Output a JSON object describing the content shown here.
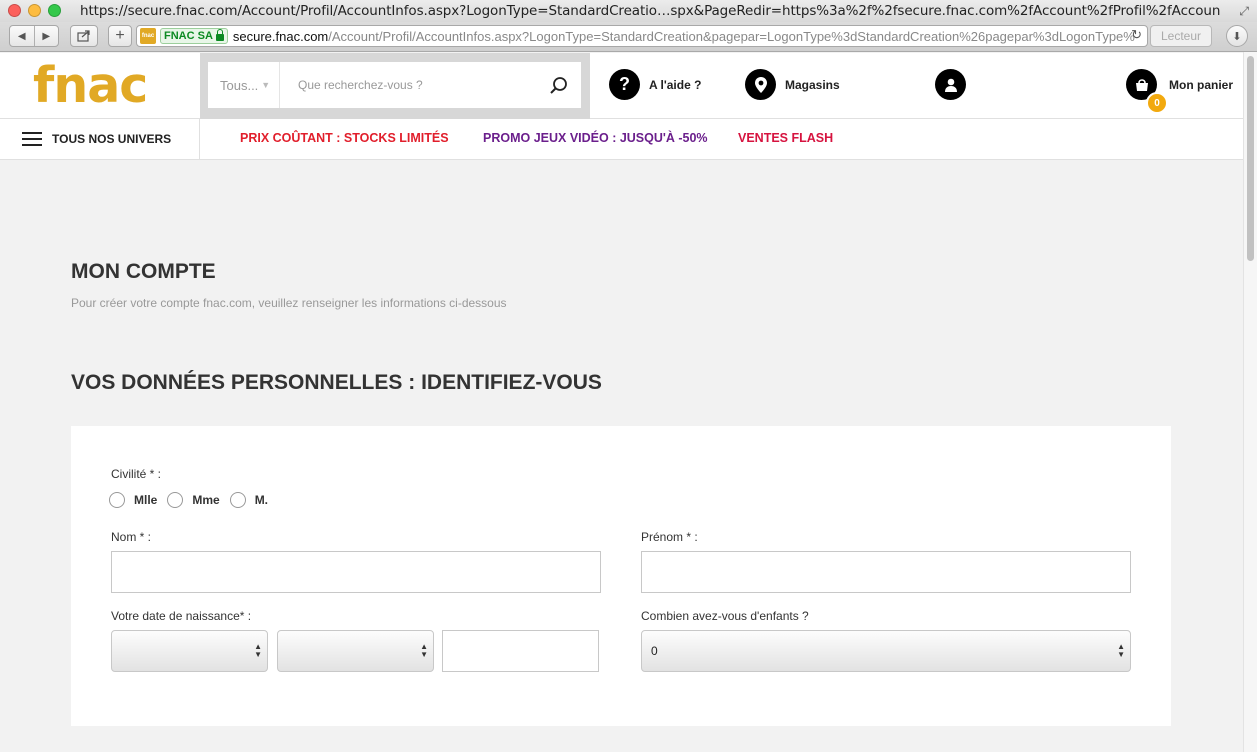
{
  "browser": {
    "window_title": "https://secure.fnac.com/Account/Profil/AccountInfos.aspx?LogonType=StandardCreatio…spx&PageRedir=https%3a%2f%2fsecure.fnac.com%2fAccount%2fProfil%2fAccountInfos.aspx",
    "ev_cert_label": "FNAC SA",
    "url_host": "secure.fnac.com",
    "url_path": "/Account/Profil/AccountInfos.aspx?LogonType=StandardCreation&pagepar=LogonType%3dStandardCreation%26pagepar%3dLogonType%",
    "reader_label": "Lecteur"
  },
  "header": {
    "logo": "fnac",
    "search_category": "Tous...",
    "search_placeholder": "Que recherchez-vous ?",
    "help_label": "A l'aide ?",
    "stores_label": "Magasins",
    "cart_label": "Mon panier",
    "cart_count": "0"
  },
  "nav": {
    "univers_label": "TOUS NOS UNIVERS",
    "promos": [
      {
        "label": "PRIX COÛTANT : STOCKS LIMITÉS",
        "color": "#e11e2b"
      },
      {
        "label": "PROMO JEUX VIDÉO : JUSQU'À -50%",
        "color": "#6b1f8c"
      },
      {
        "label": "VENTES FLASH",
        "color": "#d6133f"
      }
    ]
  },
  "page": {
    "title_light": "MON ",
    "title_bold": "COMPTE",
    "subtitle": "Pour créer votre compte fnac.com, veuillez renseigner les informations ci-dessous",
    "section_light": "VOS DONNÉES PERSONNELLES : ",
    "section_bold": "IDENTIFIEZ-VOUS"
  },
  "form": {
    "civility_label": "Civilité * :",
    "civility_options": [
      "Mlle",
      "Mme",
      "M."
    ],
    "lastname_label": "Nom * :",
    "lastname_value": "",
    "firstname_label": "Prénom * :",
    "firstname_value": "",
    "birthdate_label": "Votre date de naissance* :",
    "birth_day_value": "",
    "birth_month_value": "",
    "birth_year_value": "",
    "children_label": "Combien avez-vous d'enfants ?",
    "children_value": "0"
  },
  "colors": {
    "brand": "#e1a925",
    "cart_badge": "#f2a90e"
  }
}
